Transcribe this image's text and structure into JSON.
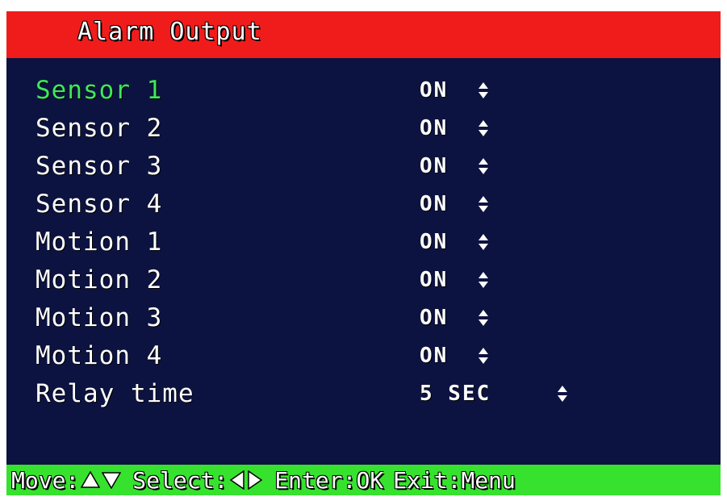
{
  "title": "Alarm Output",
  "menu": {
    "items": [
      {
        "label": "Sensor 1",
        "value": "ON"
      },
      {
        "label": "Sensor 2",
        "value": "ON"
      },
      {
        "label": "Sensor 3",
        "value": "ON"
      },
      {
        "label": "Sensor 4",
        "value": "ON"
      },
      {
        "label": "Motion 1",
        "value": "ON"
      },
      {
        "label": "Motion 2",
        "value": "ON"
      },
      {
        "label": "Motion 3",
        "value": "ON"
      },
      {
        "label": "Motion 4",
        "value": "ON"
      },
      {
        "label": "Relay time",
        "value": "5 SEC"
      }
    ],
    "selected_label": "Sensor 1",
    "value_adjust_icon": "up-down-arrows-icon"
  },
  "footer": {
    "move_label": "Move:",
    "move_icons": [
      "up-arrow-icon",
      "down-arrow-icon"
    ],
    "select_label": "Select:",
    "select_icons": [
      "left-arrow-icon",
      "right-arrow-icon"
    ],
    "enter_label": "Enter:OK",
    "exit_label": "Exit:Menu"
  },
  "colors": {
    "title_bar": "#f01c1c",
    "background": "#0d1340",
    "footer_bar": "#36e22e",
    "selected_text": "#3ee85a",
    "text": "#ffffff"
  }
}
